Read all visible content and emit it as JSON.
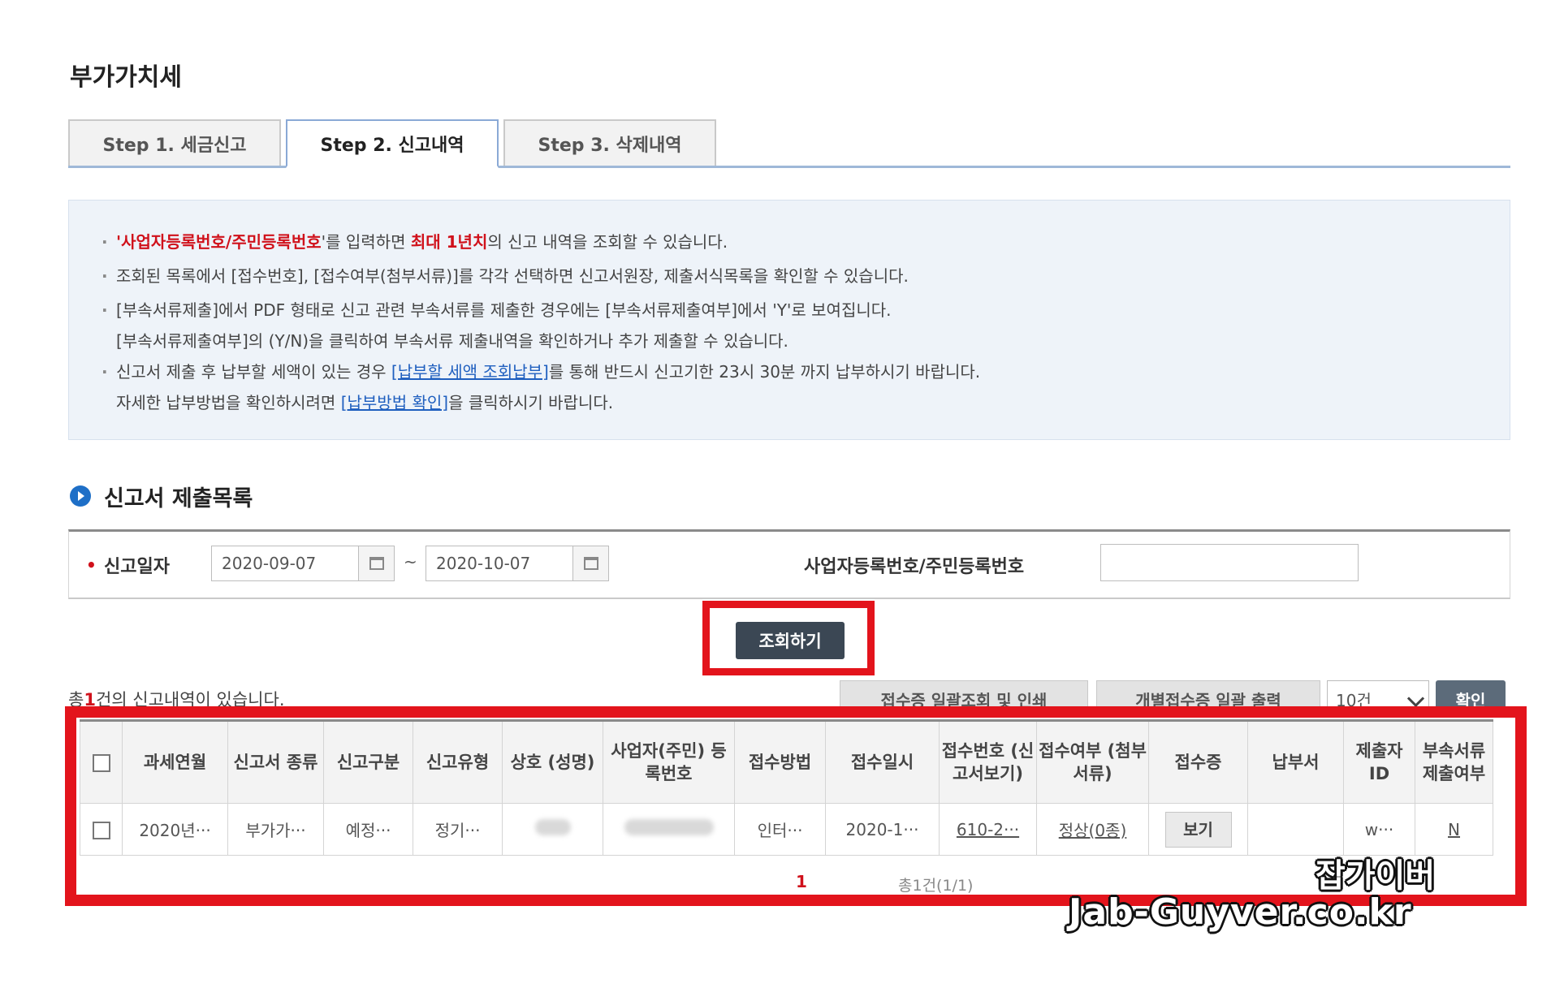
{
  "page": {
    "title": "부가가치세"
  },
  "tabs": [
    {
      "label": "Step 1. 세금신고"
    },
    {
      "label": "Step 2. 신고내역"
    },
    {
      "label": "Step 3. 삭제내역"
    }
  ],
  "info": {
    "l1_quote_open": "'",
    "l1_red1": "사업자등록번호/주민등록번호",
    "l1_mid": "'를 입력하면 ",
    "l1_red2": "최대 1년치",
    "l1_end": "의 신고 내역을 조회할 수 있습니다.",
    "l2": "조회된 목록에서 [접수번호], [접수여부(첨부서류)]를 각각 선택하면 신고서원장, 제출서식목록을 확인할 수 있습니다.",
    "l3": "[부속서류제출]에서 PDF 형태로 신고 관련 부속서류를 제출한 경우에는 [부속서류제출여부]에서 'Y'로 보여집니다.",
    "l4": "[부속서류제출여부]의 (Y/N)을 클릭하여 부속서류 제출내역을 확인하거나 추가 제출할 수 있습니다.",
    "l5_start": "신고서 제출 후 납부할 세액이 있는 경우 ",
    "l5_link": "[납부할 세액 조회납부]",
    "l5_end": "를 통해 반드시 신고기한 23시 30분 까지 납부하시기 바랍니다.",
    "l6_start": "자세한 납부방법을 확인하시려면 ",
    "l6_link": "[납부방법 확인]",
    "l6_end": "을 클릭하시기 바랍니다."
  },
  "section": {
    "title": "신고서 제출목록"
  },
  "search": {
    "date_label": "신고일자",
    "date_from": "2020-09-07",
    "tilde": "~",
    "date_to": "2020-10-07",
    "biz_label": "사업자등록번호/주민등록번호",
    "biz_value": ""
  },
  "query_button": "조회하기",
  "summary": {
    "prefix": "총",
    "count": "1",
    "suffix": "건의 신고내역이 있습니다."
  },
  "actions": {
    "bulk_view": "접수증 일괄조회 및 인쇄",
    "bulk_print": "개별접수증 일괄 출력",
    "page_size": "10건",
    "confirm": "확인"
  },
  "table": {
    "headers": [
      "",
      "과세연월",
      "신고서 종류",
      "신고구분",
      "신고유형",
      "상호 (성명)",
      "사업자(주민) 등록번호",
      "접수방법",
      "접수일시",
      "접수번호 (신고서보기)",
      "접수여부 (첨부서류)",
      "접수증",
      "납부서",
      "제출자 ID",
      "부속서류 제출여부"
    ],
    "row": {
      "period": "2020년···",
      "form_type": "부가가···",
      "category": "예정···",
      "type": "정기···",
      "receipt_method": "인터···",
      "received_at": "2020-1···",
      "receipt_no": "610-2···",
      "status": "정상(0종)",
      "view": "보기",
      "submitter": "w···",
      "attach": "N"
    }
  },
  "pager": {
    "current": "1",
    "info": "총1건(1/1)"
  },
  "watermark": {
    "line1": "잡가이버",
    "line2": "Jab-Guyver.co.kr"
  },
  "colors": {
    "highlight_red": "#e3141c",
    "link_blue": "#1f5fbf",
    "accent_blue": "#1e6fc7"
  }
}
